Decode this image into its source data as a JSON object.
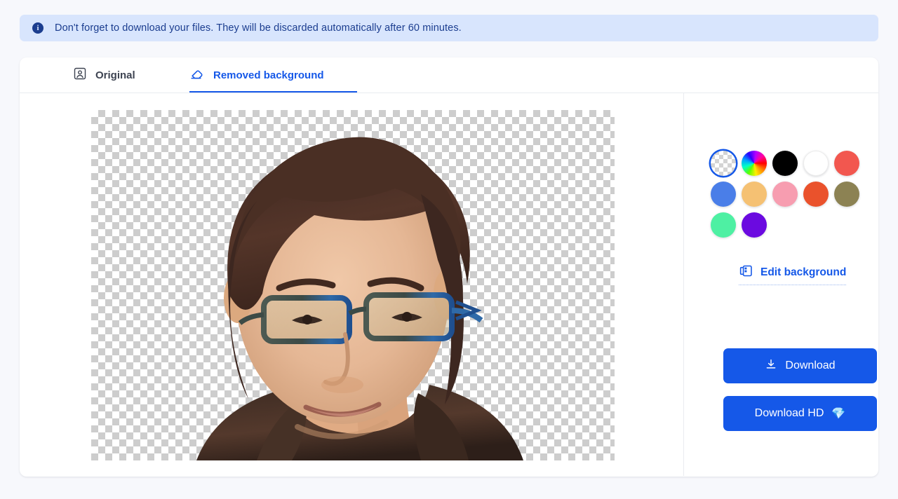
{
  "banner": {
    "icon": "info-icon",
    "text": "Don't forget to download your files. They will be discarded automatically after 60 minutes."
  },
  "tabs": [
    {
      "id": "original",
      "label": "Original",
      "icon": "portrait-icon",
      "active": false
    },
    {
      "id": "removed-background",
      "label": "Removed background",
      "icon": "eraser-icon",
      "active": true
    }
  ],
  "preview": {
    "description": "Portrait photo of a man with glasses and dark hair wearing a brown leather jacket on a transparent checkerboard background",
    "background": "transparent-checkerboard"
  },
  "sidebar": {
    "swatches": [
      {
        "name": "transparent",
        "color": "transparent",
        "selected": true
      },
      {
        "name": "color-picker",
        "color": "rainbow",
        "selected": false
      },
      {
        "name": "black",
        "color": "#000000",
        "selected": false
      },
      {
        "name": "white",
        "color": "#ffffff",
        "selected": false
      },
      {
        "name": "red",
        "color": "#f2574f",
        "selected": false
      },
      {
        "name": "blue",
        "color": "#4a7ee8",
        "selected": false
      },
      {
        "name": "peach",
        "color": "#f5c173",
        "selected": false
      },
      {
        "name": "pink",
        "color": "#f79db0",
        "selected": false
      },
      {
        "name": "orange",
        "color": "#ea522c",
        "selected": false
      },
      {
        "name": "olive",
        "color": "#8c8253",
        "selected": false
      },
      {
        "name": "spring-green",
        "color": "#4ef0a3",
        "selected": false
      },
      {
        "name": "violet",
        "color": "#6b0ae0",
        "selected": false
      }
    ],
    "edit_background": {
      "label": "Edit background",
      "icon": "layers-image-icon"
    },
    "download": {
      "label": "Download",
      "icon": "download-icon"
    },
    "download_hd": {
      "label": "Download HD",
      "gem": "💎"
    }
  },
  "colors": {
    "accent": "#1558e8",
    "banner_bg": "#d8e5fd",
    "banner_text": "#1b3d8f",
    "page_bg": "#f7f8fc",
    "card_bg": "#ffffff"
  }
}
